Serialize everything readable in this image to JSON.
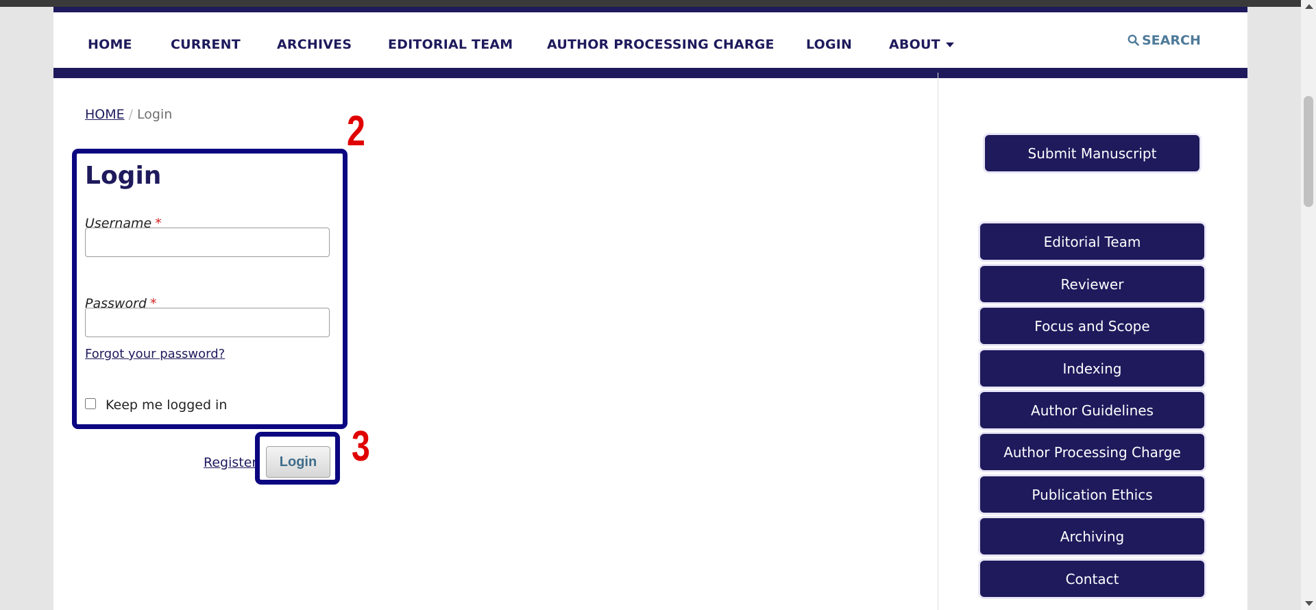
{
  "nav": {
    "items": [
      "HOME",
      "CURRENT",
      "ARCHIVES",
      "EDITORIAL TEAM",
      "AUTHOR PROCESSING CHARGE",
      "LOGIN",
      "ABOUT"
    ],
    "search_label": "SEARCH"
  },
  "breadcrumb": {
    "home": "HOME",
    "separator": "/",
    "current": "Login"
  },
  "annotations": {
    "form_number": "2",
    "button_number": "3"
  },
  "login_form": {
    "title": "Login",
    "username_label": "Username",
    "password_label": "Password",
    "required_mark": "*",
    "username_value": "",
    "password_value": "",
    "forgot_link": "Forgot your password?",
    "remember_label": "Keep me logged in",
    "remember_checked": false,
    "register_link": "Register",
    "submit_label": "Login"
  },
  "sidebar": {
    "submit_button": "Submit Manuscript",
    "menu": [
      "Editorial Team",
      "Reviewer",
      "Focus and Scope",
      "Indexing",
      "Author Guidelines",
      "Author Processing Charge",
      "Publication Ethics",
      "Archiving",
      "Contact"
    ]
  },
  "colors": {
    "brand_navy": "#1e1a5c",
    "annotation_blue": "#0b0680",
    "annotation_red": "#e00000",
    "search_blue": "#4e7a99"
  },
  "icons": {
    "search": "search-icon",
    "caret": "caret-down-icon"
  }
}
